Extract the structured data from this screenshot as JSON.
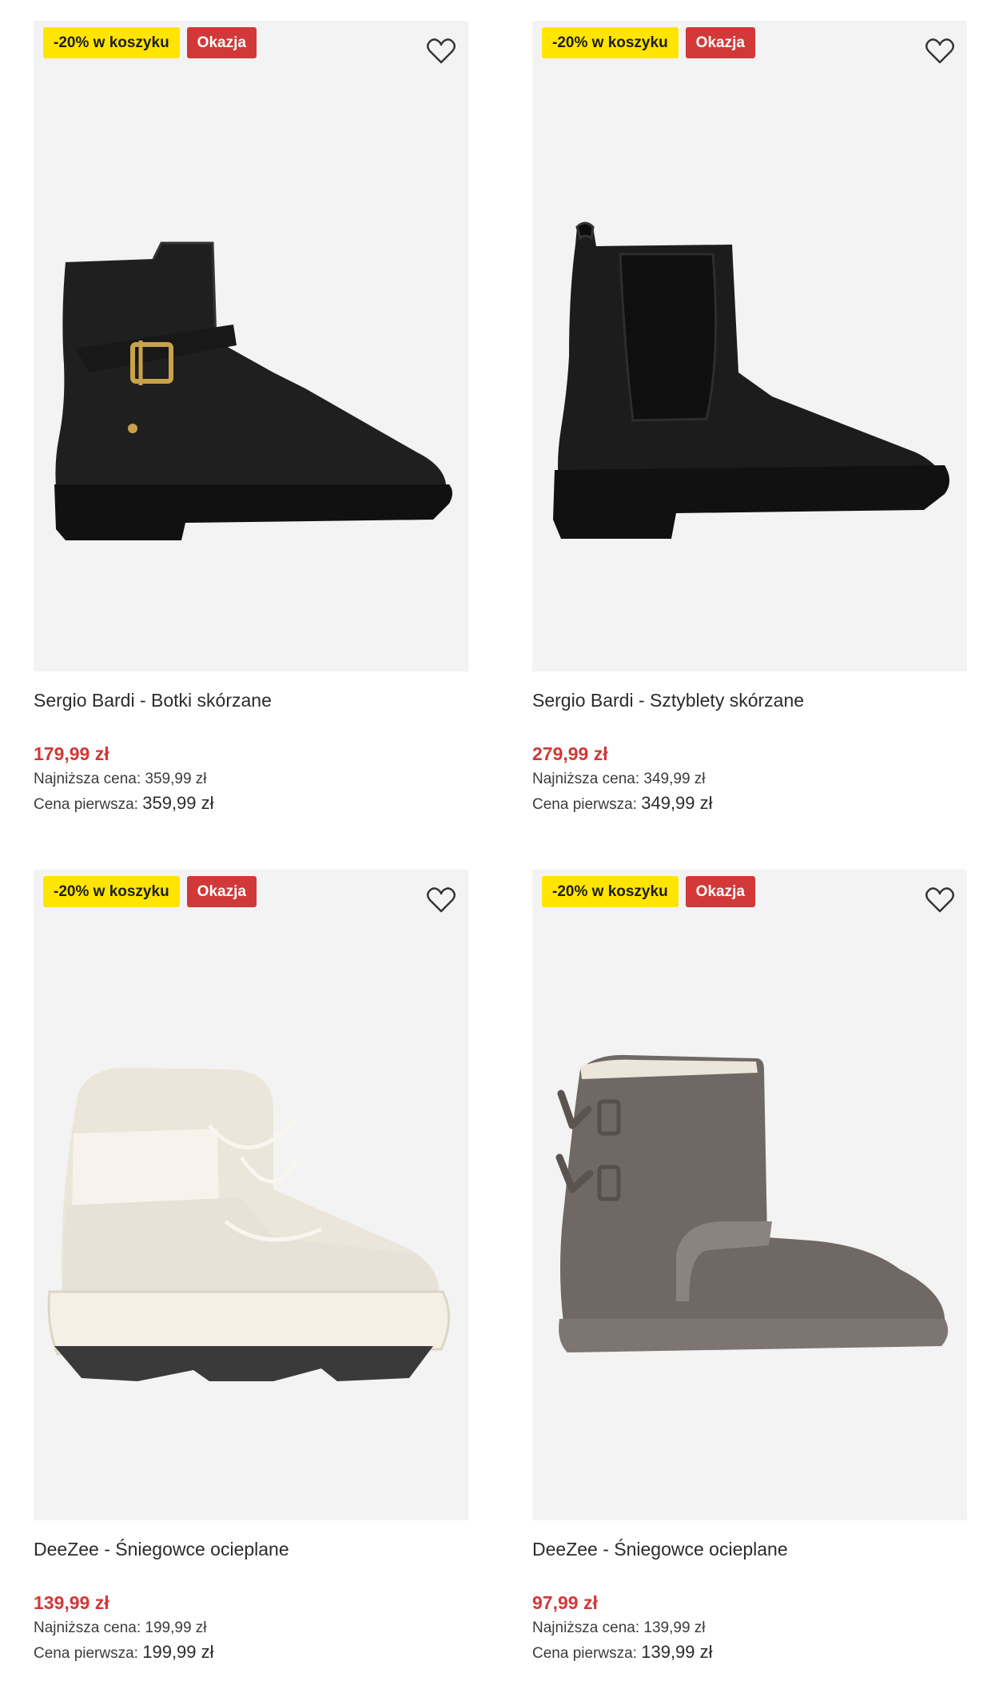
{
  "colors": {
    "promo_badge": "#ffe500",
    "deal_badge": "#d23838",
    "price": "#d23838",
    "image_bg": "#f3f3f3"
  },
  "products": [
    {
      "badge_promo": "-20% w koszyku",
      "badge_deal": "Okazja",
      "title": "Sergio Bardi - Botki skórzane",
      "price": "179,99 zł",
      "lowest_label": "Najniższa cena:",
      "lowest_value": "359,99 zł",
      "first_label": "Cena pierwsza:",
      "first_value": "359,99 zł",
      "image": "black-ankle-boot-buckle",
      "icon": "heart-icon"
    },
    {
      "badge_promo": "-20% w koszyku",
      "badge_deal": "Okazja",
      "title": "Sergio Bardi - Sztyblety skórzane",
      "price": "279,99 zł",
      "lowest_label": "Najniższa cena:",
      "lowest_value": "349,99 zł",
      "first_label": "Cena pierwsza:",
      "first_value": "349,99 zł",
      "image": "black-chelsea-boot",
      "icon": "heart-icon"
    },
    {
      "badge_promo": "-20% w koszyku",
      "badge_deal": "Okazja",
      "title": "DeeZee - Śniegowce ocieplane",
      "price": "139,99 zł",
      "lowest_label": "Najniższa cena:",
      "lowest_value": "199,99 zł",
      "first_label": "Cena pierwsza:",
      "first_value": "199,99 zł",
      "image": "cream-snow-boot",
      "icon": "heart-icon"
    },
    {
      "badge_promo": "-20% w koszyku",
      "badge_deal": "Okazja",
      "title": "DeeZee - Śniegowce ocieplane",
      "price": "97,99 zł",
      "lowest_label": "Najniższa cena:",
      "lowest_value": "139,99 zł",
      "first_label": "Cena pierwsza:",
      "first_value": "139,99 zł",
      "image": "grey-bow-snow-boot",
      "icon": "heart-icon"
    }
  ]
}
